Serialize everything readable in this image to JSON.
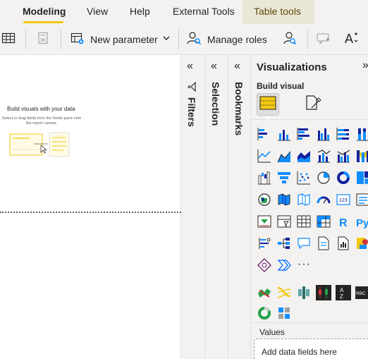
{
  "ribbon": {
    "tabs": [
      {
        "label": "Modeling"
      },
      {
        "label": "View"
      },
      {
        "label": "Help"
      },
      {
        "label": "External Tools"
      },
      {
        "label": "Table tools"
      }
    ]
  },
  "toolbar": {
    "new_parameter_label": "New parameter",
    "manage_roles_label": "Manage roles"
  },
  "canvas": {
    "placeholder_title": "Build visuals with your data",
    "placeholder_subtitle": "Select or drag fields from the Fields pane onto the report canvas."
  },
  "panes": {
    "filters_label": "Filters",
    "selection_label": "Selection",
    "bookmarks_label": "Bookmarks"
  },
  "visualizations": {
    "title": "Visualizations",
    "build_visual_label": "Build visual",
    "values_label": "Values",
    "drop_zone_text": "Add data fields here"
  },
  "icons": {
    "accent_yellow": "#f2c811",
    "accent_blue": "#118dff",
    "dark_blue": "#12239e"
  }
}
